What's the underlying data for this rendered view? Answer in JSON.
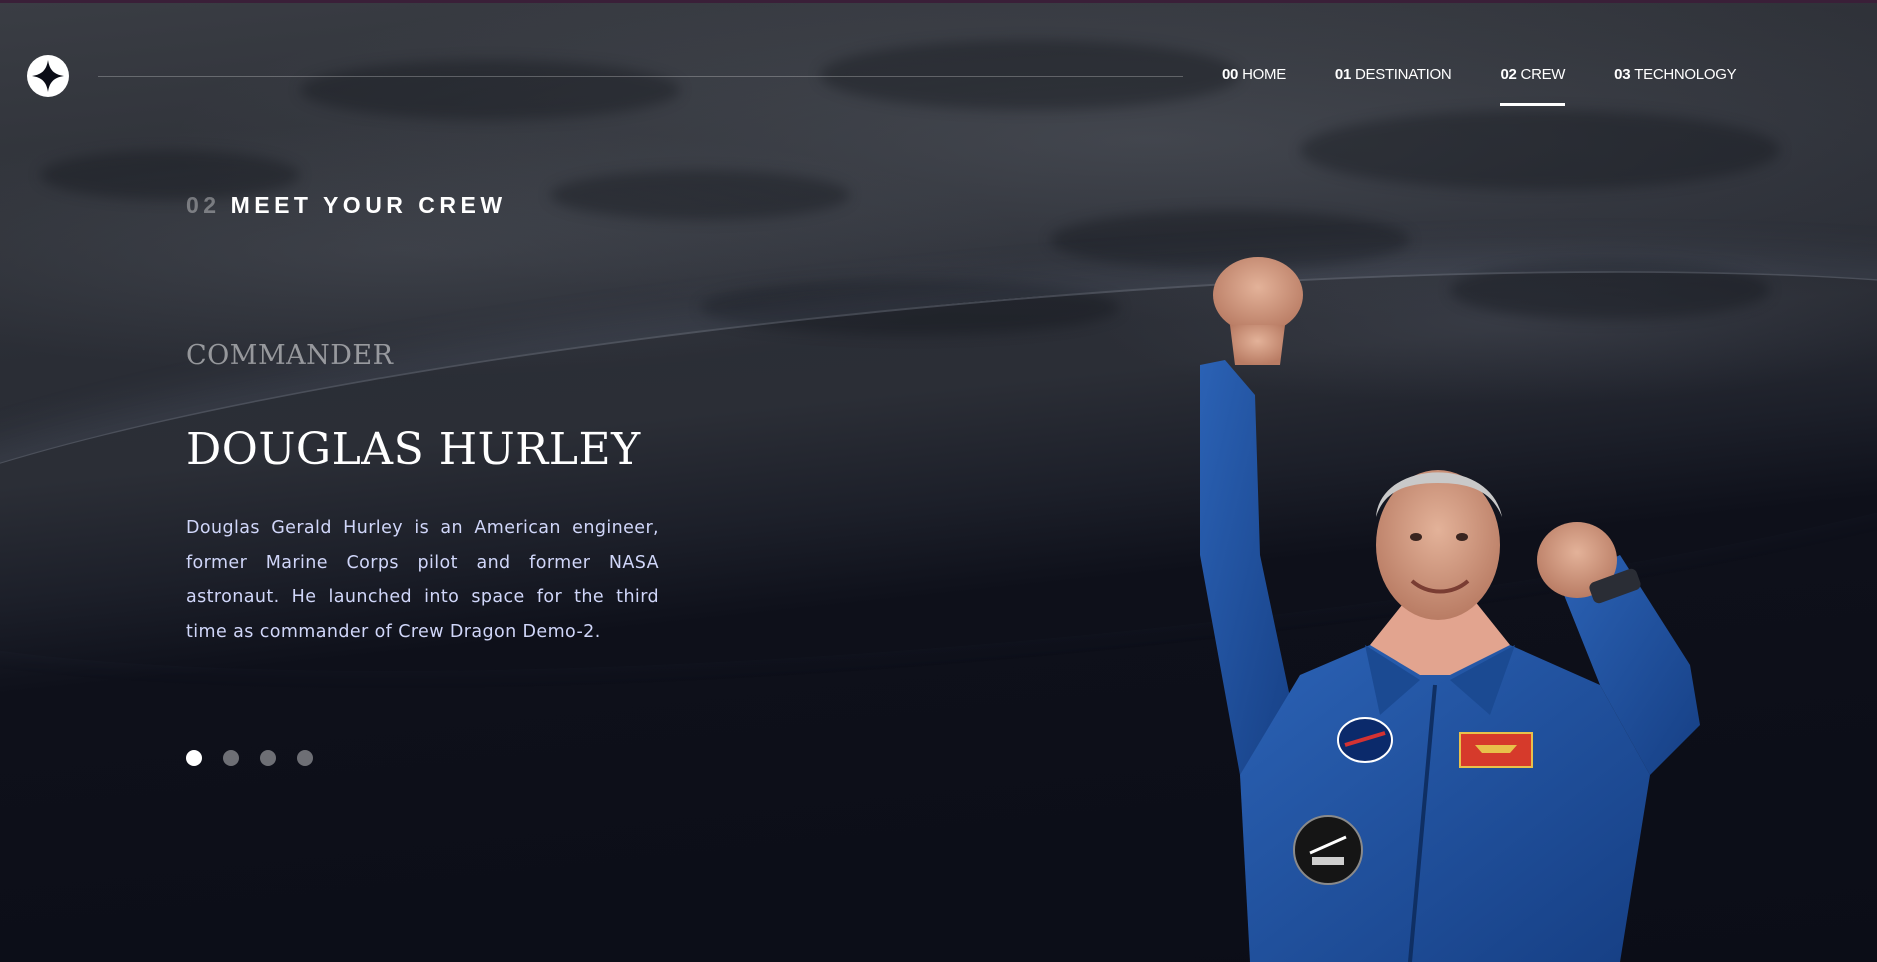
{
  "nav": {
    "items": [
      {
        "num": "00",
        "label": "HOME",
        "active": false
      },
      {
        "num": "01",
        "label": "DESTINATION",
        "active": false
      },
      {
        "num": "02",
        "label": "CREW",
        "active": true
      },
      {
        "num": "03",
        "label": "TECHNOLOGY",
        "active": false
      }
    ]
  },
  "section": {
    "num": "02",
    "title": "MEET YOUR CREW"
  },
  "crew": {
    "role": "COMMANDER",
    "name": "DOUGLAS HURLEY",
    "bio": "Douglas Gerald Hurley is an American engineer, former Marine Corps pilot and former NASA astronaut. He launched into space for the third time as commander of Crew Dragon Demo-2.",
    "slide_count": 4,
    "active_slide": 1
  },
  "colors": {
    "background": "#0b0d17",
    "text_light": "#d0d6f9",
    "accent": "#ffffff",
    "suit_blue": "#1f4f9c"
  },
  "icons": {
    "logo": "star-logo-icon"
  }
}
